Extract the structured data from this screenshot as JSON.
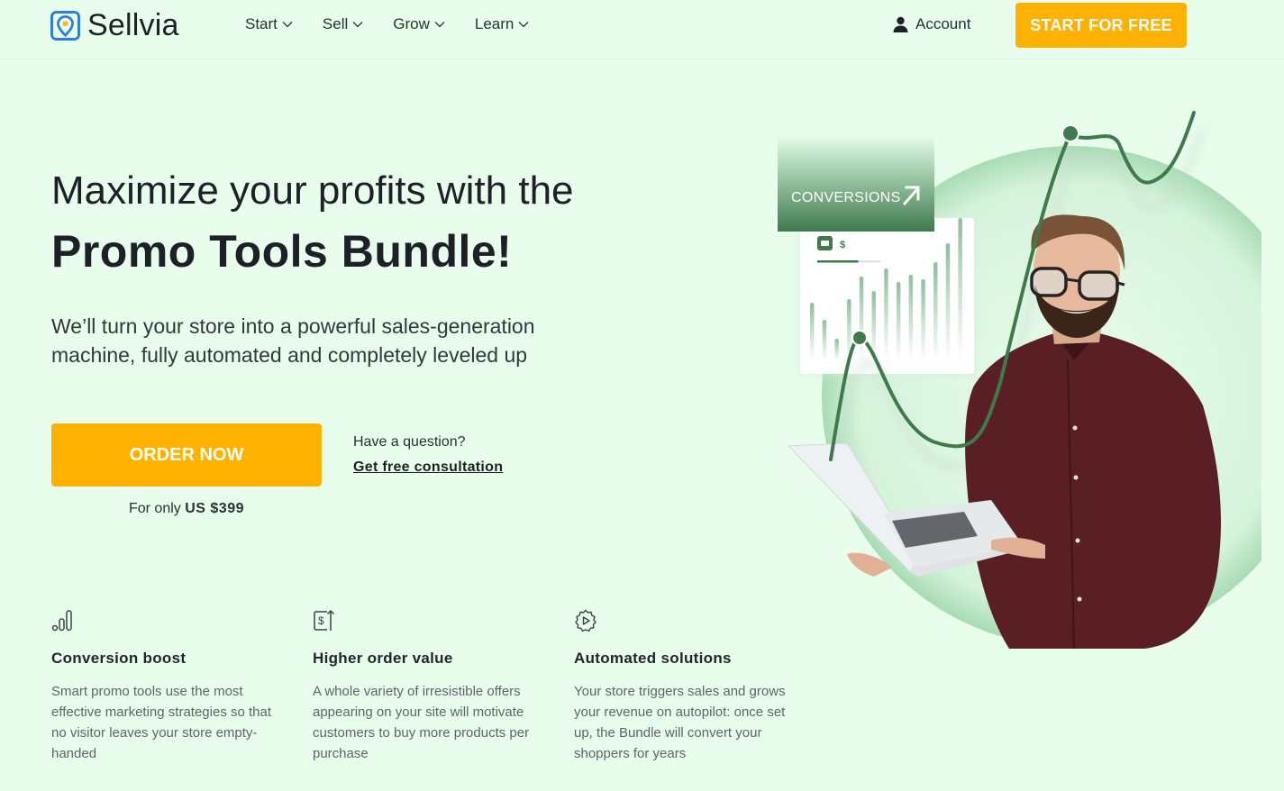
{
  "header": {
    "brand": "Sellvia",
    "nav": [
      {
        "label": "Start"
      },
      {
        "label": "Sell"
      },
      {
        "label": "Grow"
      },
      {
        "label": "Learn"
      }
    ],
    "account_label": "Account",
    "cta_label": "START FOR FREE"
  },
  "hero": {
    "title_line1": "Maximize your profits with the",
    "title_line2": "Promo Tools Bundle!",
    "subtitle": "We’ll turn your store into a powerful sales-generation machine, fully automated and completely leveled up",
    "order_label": "ORDER NOW",
    "price_prefix": "For only",
    "price_value": "US $399",
    "question": "Have a question?",
    "consult_link": "Get free consultation"
  },
  "illustration": {
    "badge_label": "CONVERSIONS",
    "card_currency": "$",
    "card_progress": 0.65
  },
  "features": [
    {
      "icon": "bar-chart-icon",
      "title": "Conversion boost",
      "text": "Smart promo tools use the most effective marketing strategies so that no visitor leaves your store empty-handed"
    },
    {
      "icon": "dollar-up-icon",
      "title": "Higher order value",
      "text": "A whole variety of irresistible offers appearing on your site will motivate customers to buy more products per purchase"
    },
    {
      "icon": "gear-play-icon",
      "title": "Automated solutions",
      "text": "Your store triggers sales and grows your revenue on autopilot: once set up, the Bundle will convert your shoppers for years"
    }
  ],
  "colors": {
    "background": "#e8fdec",
    "accent": "#ffb100",
    "brand_green": "#3f7a4d",
    "logo_blue": "#2f7fd6"
  }
}
